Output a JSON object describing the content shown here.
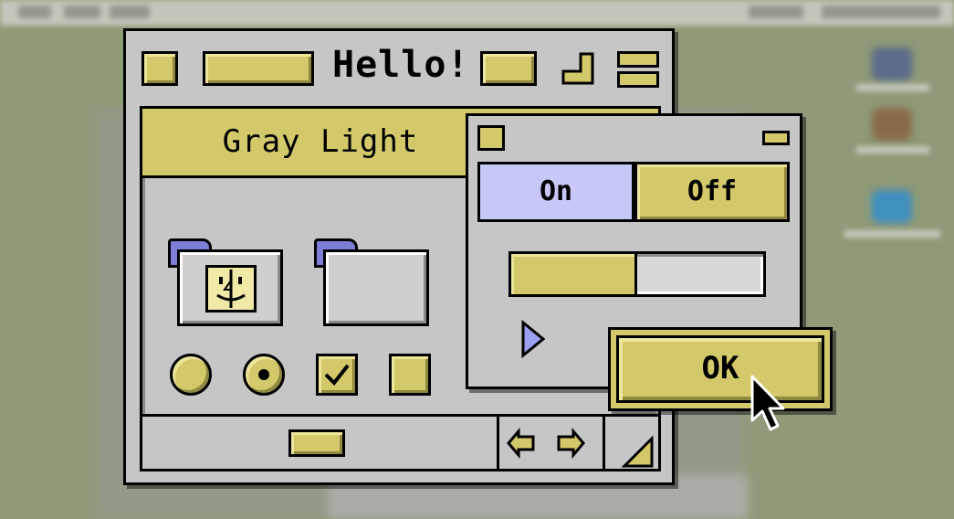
{
  "window": {
    "title": "Hello!"
  },
  "header": {
    "label": "Gray Light"
  },
  "panel": {
    "segment_on": "On",
    "segment_off": "Off",
    "progress_fraction": 0.5
  },
  "dialog": {
    "ok_label": "OK"
  },
  "controls": {
    "radio_1_selected": false,
    "radio_2_selected": true,
    "checkbox_1_checked": true,
    "checkbox_2_checked": false
  },
  "colors": {
    "accent_yellow": "#d4c96a",
    "highlight_lavender": "#c7c8f8",
    "folder_blue": "#7d7fd6",
    "window_gray": "#c6c6c6",
    "desktop": "#8e9a78"
  },
  "icons": [
    "close-box-icon",
    "zoom-box-icon",
    "collapse-box-icon",
    "window-shade-icon",
    "finder-face-icon",
    "folder-tab-icon",
    "scroll-left-arrow-icon",
    "scroll-right-arrow-icon",
    "grow-box-icon",
    "disclosure-triangle-icon",
    "arrow-cursor-icon"
  ]
}
